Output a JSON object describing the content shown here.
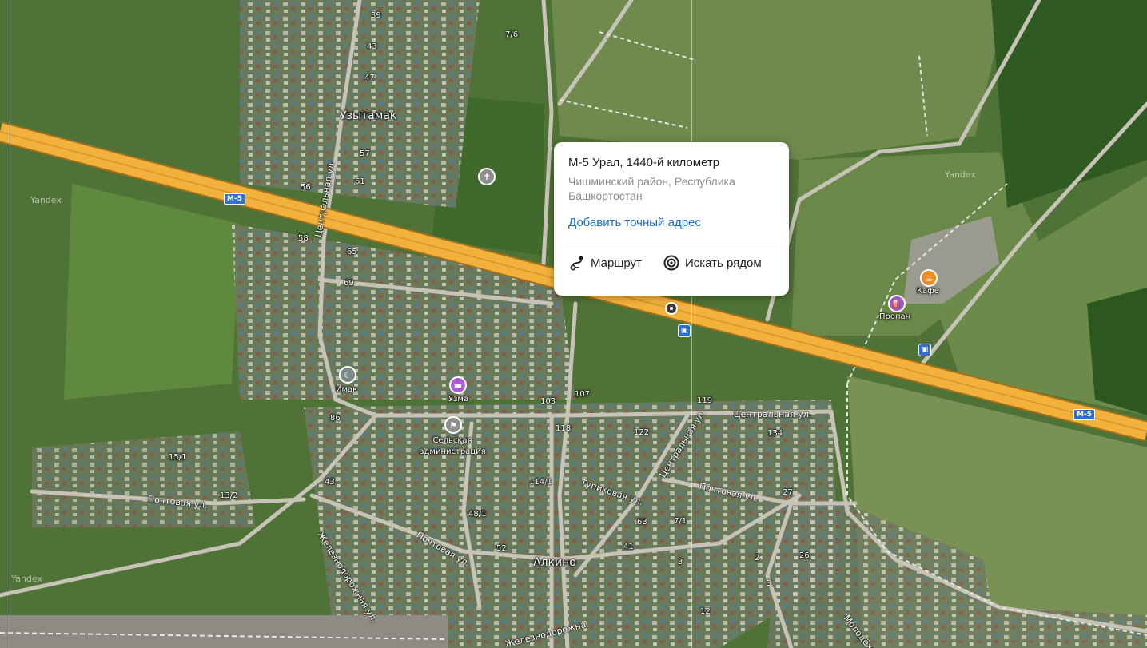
{
  "popup": {
    "title": "М-5 Урал, 1440-й километр",
    "subtitle": "Чишминский район, Республика Башкортостан",
    "add_address": "Добавить точный адрес",
    "route_label": "Маршрут",
    "nearby_label": "Искать рядом"
  },
  "map": {
    "highway_shield": "М-5",
    "places": {
      "uzytamak": "Узытамак",
      "alkino": "Алкино",
      "imak": "Имак",
      "uzma": "Узма",
      "admin": "Сельская администрация",
      "cafe": "Кафе",
      "propan": "Пропан"
    },
    "streets": {
      "centralnaya": "Центральная ул.",
      "pochtovaya": "Почтовая ул.",
      "tupikovaya": "Тупиковая ул.",
      "zheleznodorozhnaya": "Железнодорожная ул.",
      "zheleznodorozhnaya_partial": "Железнодорожна",
      "molodezhnaya": "Молодёжная"
    },
    "house_numbers": [
      "39",
      "43",
      "47",
      "57",
      "61",
      "56",
      "58",
      "65",
      "69",
      "86",
      "103",
      "107",
      "118",
      "119",
      "122",
      "134",
      "15/1",
      "13/2",
      "43",
      "48/1",
      "52",
      "114/1",
      "63",
      "7/1",
      "41",
      "3",
      "2",
      "3",
      "12",
      "27",
      "26",
      "7/6"
    ],
    "watermark": "Yandex"
  },
  "colors": {
    "highway": "#f2b13a",
    "link": "#1a6cd8",
    "cafe": "#f08a24",
    "propan": "#9b59d0",
    "shield": "#2f6fd1"
  },
  "icons": {
    "route": "route-icon",
    "nearby": "target-icon",
    "pin": "location-pin-icon"
  }
}
